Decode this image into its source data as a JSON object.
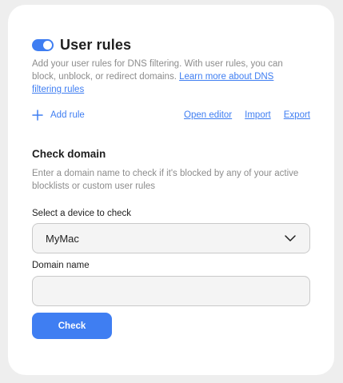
{
  "user_rules": {
    "title": "User rules",
    "toggle_enabled": true,
    "description": "Add your user rules for DNS filtering. With user rules, you can block, unblock, or redirect domains. ",
    "learn_more_link": "Learn more about DNS filtering rules",
    "add_rule_label": "Add rule",
    "open_editor_label": "Open editor",
    "import_label": "Import",
    "export_label": "Export"
  },
  "check_domain": {
    "title": "Check domain",
    "description": "Enter a domain name to check if it's blocked by any of your active blocklists or custom user rules",
    "device_label": "Select a device to check",
    "device_value": "MyMac",
    "domain_label": "Domain name",
    "domain_value": "",
    "domain_placeholder": "",
    "check_button_label": "Check"
  },
  "colors": {
    "accent": "#3f7ef2",
    "muted_text": "#8c8c8c",
    "field_background": "#f4f4f4",
    "page_background": "#eeeeee"
  },
  "icons": {
    "add": "plus-icon",
    "select": "chevron-down-icon"
  }
}
